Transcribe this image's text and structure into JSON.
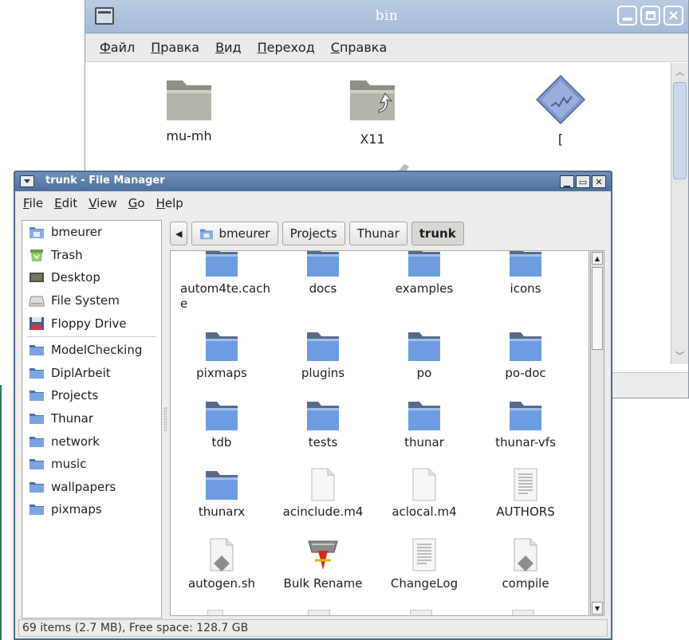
{
  "back_window": {
    "title": "bin",
    "menu": [
      "Файл",
      "Правка",
      "Вид",
      "Переход",
      "Справка"
    ],
    "items": [
      {
        "label": "mu-mh",
        "icon": "folder-icon"
      },
      {
        "label": "X11",
        "icon": "folder-link-icon"
      },
      {
        "label": "[",
        "icon": "executable-icon"
      }
    ]
  },
  "front_window": {
    "title": "trunk - File Manager",
    "menu": [
      "File",
      "Edit",
      "View",
      "Go",
      "Help"
    ],
    "sidebar": {
      "places": [
        {
          "label": "bmeurer",
          "icon": "home-folder-icon"
        },
        {
          "label": "Trash",
          "icon": "trash-icon"
        },
        {
          "label": "Desktop",
          "icon": "desktop-icon"
        },
        {
          "label": "File System",
          "icon": "harddisk-icon"
        },
        {
          "label": "Floppy Drive",
          "icon": "floppy-icon"
        }
      ],
      "bookmarks": [
        {
          "label": "ModelChecking",
          "icon": "folder-icon"
        },
        {
          "label": "DiplArbeit",
          "icon": "folder-icon"
        },
        {
          "label": "Projects",
          "icon": "folder-icon"
        },
        {
          "label": "Thunar",
          "icon": "folder-icon"
        },
        {
          "label": "network",
          "icon": "folder-icon"
        },
        {
          "label": "music",
          "icon": "folder-icon"
        },
        {
          "label": "wallpapers",
          "icon": "folder-icon"
        },
        {
          "label": "pixmaps",
          "icon": "folder-icon"
        }
      ]
    },
    "pathbar": [
      "bmeurer",
      "Projects",
      "Thunar",
      "trunk"
    ],
    "files": [
      {
        "label": "autom4te.cache",
        "icon": "folder-icon"
      },
      {
        "label": "docs",
        "icon": "folder-icon"
      },
      {
        "label": "examples",
        "icon": "folder-icon"
      },
      {
        "label": "icons",
        "icon": "folder-icon"
      },
      {
        "label": "pixmaps",
        "icon": "folder-icon"
      },
      {
        "label": "plugins",
        "icon": "folder-icon"
      },
      {
        "label": "po",
        "icon": "folder-icon"
      },
      {
        "label": "po-doc",
        "icon": "folder-icon"
      },
      {
        "label": "tdb",
        "icon": "folder-icon"
      },
      {
        "label": "tests",
        "icon": "folder-icon"
      },
      {
        "label": "thunar",
        "icon": "folder-icon"
      },
      {
        "label": "thunar-vfs",
        "icon": "folder-icon"
      },
      {
        "label": "thunarx",
        "icon": "folder-icon"
      },
      {
        "label": "acinclude.m4",
        "icon": "file-icon"
      },
      {
        "label": "aclocal.m4",
        "icon": "file-icon"
      },
      {
        "label": "AUTHORS",
        "icon": "text-file-icon"
      },
      {
        "label": "autogen.sh",
        "icon": "script-icon"
      },
      {
        "label": "Bulk Rename",
        "icon": "bulk-rename-icon"
      },
      {
        "label": "ChangeLog",
        "icon": "text-file-icon"
      },
      {
        "label": "compile",
        "icon": "script-icon"
      }
    ],
    "status": "69 items (2.7 MB), Free space: 128.7 GB"
  }
}
